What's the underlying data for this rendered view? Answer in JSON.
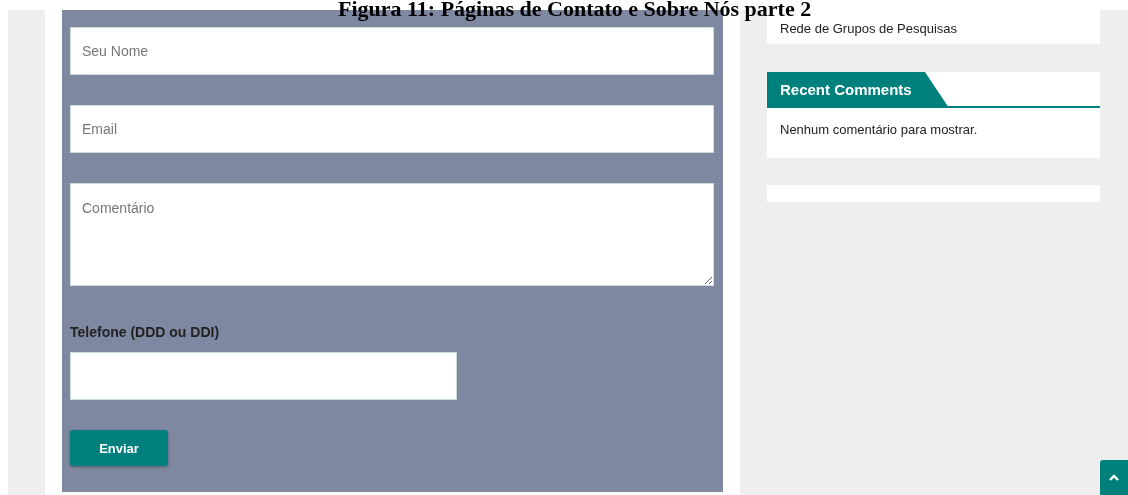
{
  "caption": "Figura 11: Páginas de Contato e Sobre Nós parte 2",
  "form": {
    "fields": [
      {
        "kind": "input",
        "placeholder": "Seu Nome"
      },
      {
        "kind": "input",
        "placeholder": "Email"
      },
      {
        "kind": "textarea",
        "placeholder": "Comentário"
      }
    ],
    "phone": {
      "label": "Telefone (DDD ou DDI)"
    },
    "submit": "Enviar"
  },
  "sidebar": {
    "top_item": "Rede de Grupos de Pesquisas",
    "widget": {
      "title": "Recent Comments",
      "text": "Nenhum comentário para mostrar."
    }
  }
}
